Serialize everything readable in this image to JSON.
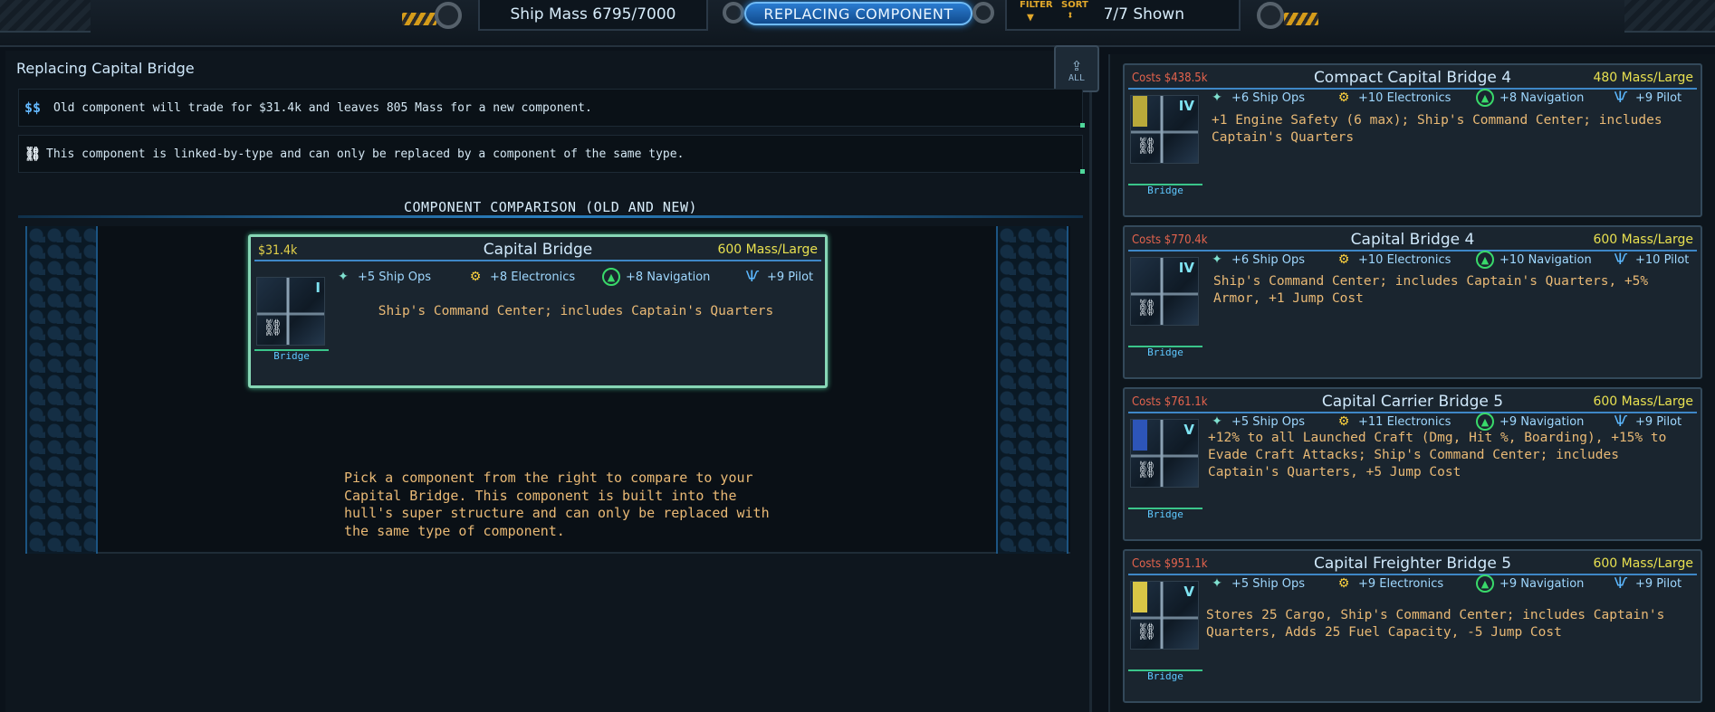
{
  "topbar": {
    "ship_mass": "Ship Mass 6795/7000",
    "mode_button": "REPLACING COMPONENT",
    "filter_label": "FILTER",
    "sort_label": "SORT",
    "shown_count": "7/7 Shown"
  },
  "left": {
    "title": "Replacing Capital Bridge",
    "info_trade": "Old component will trade for $31.4k and leaves 805 Mass for a new component.",
    "info_trade_icon": "$$",
    "info_linked": "This component is linked-by-type and can only be replaced by a component of the same type.",
    "upload_label": "ALL",
    "comparison_title": "COMPONENT COMPARISON (OLD AND NEW)",
    "hint": "Pick a component from the right to compare to your Capital Bridge. This component is built into the hull's super structure and can only be replaced with the same type of component."
  },
  "old_component": {
    "cost": "$31.4k",
    "name": "Capital Bridge",
    "mass": "600 Mass/Large",
    "tier": "I",
    "type": "Bridge",
    "stats": [
      "+5 Ship Ops",
      "+8 Electronics",
      "+8 Navigation",
      "+9 Pilot"
    ],
    "description": "Ship's Command Center; includes Captain's Quarters"
  },
  "options": [
    {
      "cost": "Costs $438.5k",
      "name": "Compact Capital Bridge 4",
      "mass": "480 Mass/Large",
      "tier": "IV",
      "type": "Bridge",
      "banner_color": "#b9a93a",
      "stats": [
        "+6 Ship Ops",
        "+10 Electronics",
        "+8 Navigation",
        "+9 Pilot"
      ],
      "description": "+1 Engine Safety (6 max); Ship's Command Center; includes Captain's Quarters"
    },
    {
      "cost": "Costs $770.4k",
      "name": "Capital Bridge 4",
      "mass": "600 Mass/Large",
      "tier": "IV",
      "type": "Bridge",
      "banner_color": "",
      "stats": [
        "+6 Ship Ops",
        "+10 Electronics",
        "+10 Navigation",
        "+10 Pilot"
      ],
      "description": "Ship's Command Center; includes Captain's Quarters, +5% Armor, +1 Jump Cost"
    },
    {
      "cost": "Costs $761.1k",
      "name": "Capital Carrier Bridge 5",
      "mass": "600 Mass/Large",
      "tier": "V",
      "type": "Bridge",
      "banner_color": "#2d55b8",
      "stats": [
        "+5 Ship Ops",
        "+11 Electronics",
        "+9 Navigation",
        "+9 Pilot"
      ],
      "description": "+12% to all Launched Craft (Dmg, Hit %, Boarding), +15% to Evade Craft Attacks; Ship's Command Center; includes Captain's Quarters, +5 Jump Cost"
    },
    {
      "cost": "Costs $951.1k",
      "name": "Capital Freighter Bridge 5",
      "mass": "600 Mass/Large",
      "tier": "V",
      "type": "Bridge",
      "banner_color": "#d9c646",
      "stats": [
        "+5 Ship Ops",
        "+9 Electronics",
        "+9 Navigation",
        "+9 Pilot"
      ],
      "description": "Stores 25 Cargo, Ship's Command Center; includes Captain's Quarters, Adds 25 Fuel Capacity, -5 Jump Cost"
    }
  ]
}
